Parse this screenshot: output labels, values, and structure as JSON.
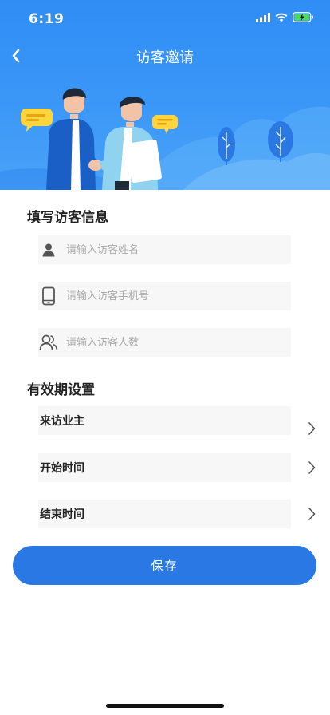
{
  "status_bar": {
    "time": "6:19"
  },
  "header": {
    "title": "访客邀请"
  },
  "visitor_info": {
    "title": "填写访客信息",
    "name_placeholder": "请输入访客姓名",
    "phone_placeholder": "请输入访客手机号",
    "count_placeholder": "请输入访客人数"
  },
  "validity": {
    "title": "有效期设置",
    "items": [
      {
        "label": "来访业主"
      },
      {
        "label": "开始时间"
      },
      {
        "label": "结束时间"
      }
    ]
  },
  "actions": {
    "save_label": "保存"
  },
  "colors": {
    "header_blue": "#3b97f7",
    "button_blue": "#2a78e4",
    "field_bg": "#f7f7f7"
  }
}
